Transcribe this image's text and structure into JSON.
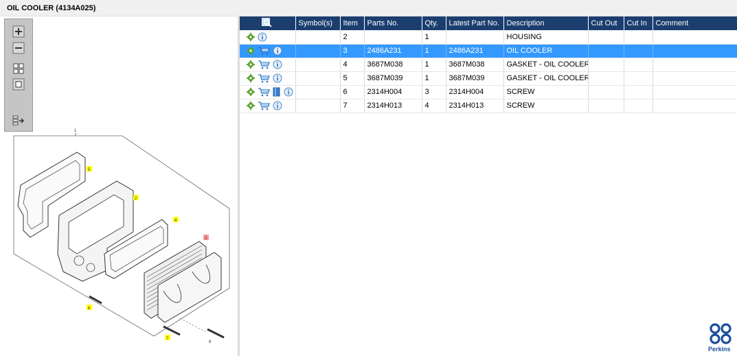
{
  "window": {
    "title": "OIL COOLER (4134A025)"
  },
  "zoom_toolbar": {
    "tools": [
      {
        "name": "zoom-in",
        "icon": "plus-icon"
      },
      {
        "name": "zoom-out",
        "icon": "minus-icon"
      },
      {
        "name": "fit-window",
        "icon": "grid-icon"
      },
      {
        "name": "actual-size",
        "icon": "square-icon"
      },
      {
        "name": "toggle-list",
        "icon": "export-icon"
      }
    ]
  },
  "diagram": {
    "callouts": [
      "1",
      "5",
      "2",
      "4",
      "3",
      "6",
      "7",
      "8"
    ]
  },
  "parts_table": {
    "header_icon": "search-icon",
    "columns": [
      "Symbol(s)",
      "Item",
      "Parts No.",
      "Qty.",
      "Latest Part No.",
      "Description",
      "Cut Out",
      "Cut In",
      "Comment"
    ],
    "selected_row": 1,
    "rows": [
      {
        "icons": [
          "gear-icon",
          "info-icon"
        ],
        "symbols": "",
        "item": "2",
        "part_no": "",
        "qty": "1",
        "latest_part_no": "",
        "description": "HOUSING",
        "cut_out": "",
        "cut_in": "",
        "comment": ""
      },
      {
        "icons": [
          "gear-icon",
          "cart-icon",
          "info-icon"
        ],
        "symbols": "",
        "item": "3",
        "part_no": "2486A231",
        "qty": "1",
        "latest_part_no": "2486A231",
        "description": "OIL COOLER",
        "cut_out": "",
        "cut_in": "",
        "comment": ""
      },
      {
        "icons": [
          "gear-icon",
          "cart-icon",
          "info-icon"
        ],
        "symbols": "",
        "item": "4",
        "part_no": "3687M038",
        "qty": "1",
        "latest_part_no": "3687M038",
        "description": "GASKET - OIL COOLER",
        "cut_out": "",
        "cut_in": "",
        "comment": ""
      },
      {
        "icons": [
          "gear-icon",
          "cart-icon",
          "info-icon"
        ],
        "symbols": "",
        "item": "5",
        "part_no": "3687M039",
        "qty": "1",
        "latest_part_no": "3687M039",
        "description": "GASKET - OIL COOLER",
        "cut_out": "",
        "cut_in": "",
        "comment": ""
      },
      {
        "icons": [
          "gear-icon",
          "cart-icon",
          "book-icon",
          "info-icon"
        ],
        "symbols": "",
        "item": "6",
        "part_no": "2314H004",
        "qty": "3",
        "latest_part_no": "2314H004",
        "description": "SCREW",
        "cut_out": "",
        "cut_in": "",
        "comment": ""
      },
      {
        "icons": [
          "gear-icon",
          "cart-icon",
          "info-icon"
        ],
        "symbols": "",
        "item": "7",
        "part_no": "2314H013",
        "qty": "4",
        "latest_part_no": "2314H013",
        "description": "SCREW",
        "cut_out": "",
        "cut_in": "",
        "comment": ""
      }
    ]
  },
  "brand": {
    "name": "Perkins",
    "color": "#1b4e9b"
  },
  "colors": {
    "header_bg": "#1b3e6f",
    "selected_row": "#3399ff",
    "callout_highlight": "#ffff00"
  }
}
